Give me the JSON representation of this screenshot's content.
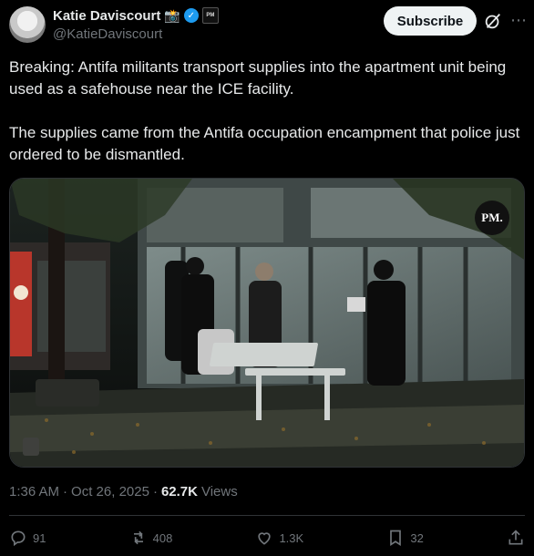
{
  "author": {
    "display_name": "Katie Daviscourt",
    "handle": "@KatieDaviscourt",
    "camera_emoji": "📸",
    "verified_icon": "verified-check-icon",
    "affiliation_badge_text": "PM"
  },
  "header": {
    "subscribe_label": "Subscribe",
    "grok_icon": "grok-icon",
    "more_icon": "more-icon"
  },
  "tweet": {
    "paragraph_1": "Breaking: Antifa militants transport supplies into the apartment unit being used as a safehouse near the ICE facility.",
    "paragraph_2": "The supplies came from the Antifa occupation encampment that police just ordered to be dismantled."
  },
  "media": {
    "watermark": "PM."
  },
  "meta": {
    "time": "1:36 AM",
    "separator": "·",
    "date": "Oct 26, 2025",
    "views_count": "62.7K",
    "views_label": "Views"
  },
  "actions": {
    "replies": "91",
    "reposts": "408",
    "likes": "1.3K",
    "bookmarks": "32"
  },
  "colors": {
    "background": "#000000",
    "text": "#e7e9ea",
    "muted": "#71767b",
    "verified": "#1d9bf0",
    "divider": "#2f3336"
  }
}
